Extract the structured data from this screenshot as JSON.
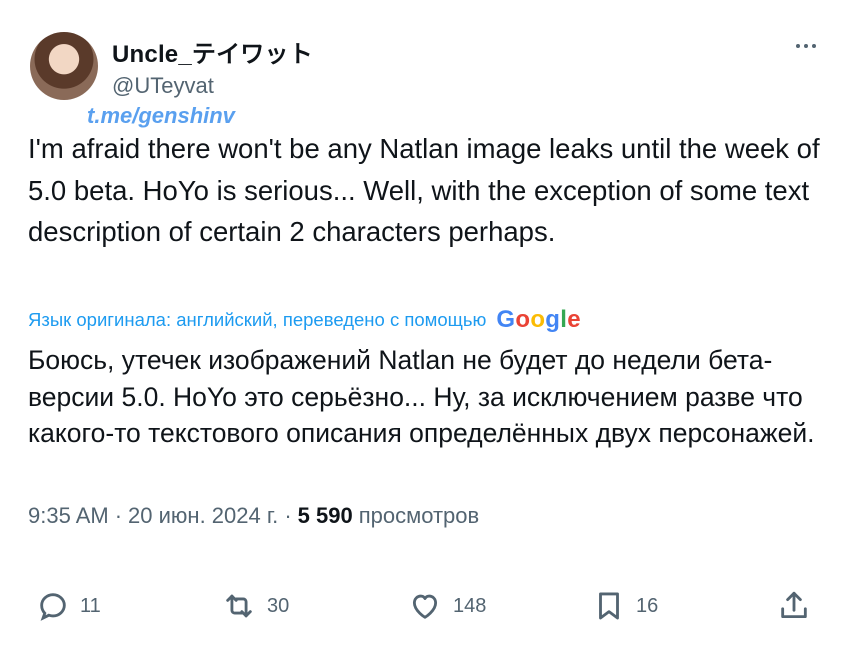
{
  "tweet": {
    "author": {
      "display_name": "Uncle_テイワット",
      "handle": "@UTeyvat"
    },
    "overlay_link": "t.me/genshinv",
    "text": "I'm afraid there won't be any Natlan image leaks until the week of 5.0 beta. HoYo is serious... Well, with the exception of some text description of certain 2 characters perhaps.",
    "translation": {
      "note": "Язык оригинала: английский, переведено с помощью",
      "provider": "Google",
      "text": "Боюсь, утечек изображений Natlan не будет до недели бета-версии 5.0. HoYo это серьёзно... Ну, за исключением разве что какого-то текстового описания определённых двух персонажей."
    },
    "meta": {
      "time": "9:35 AM",
      "separator": "·",
      "date": "20 июн. 2024 г.",
      "views_count": "5 590",
      "views_label": "просмотров"
    },
    "actions": {
      "replies": "11",
      "reposts": "30",
      "likes": "148",
      "bookmarks": "16"
    }
  },
  "icons": [
    "more-icon",
    "reply-icon",
    "repost-icon",
    "like-icon",
    "bookmark-icon",
    "share-icon"
  ],
  "colors": {
    "text": "#0f1419",
    "secondary": "#536471",
    "link": "#1d9bf0",
    "overlay": "#5aa0ef"
  }
}
